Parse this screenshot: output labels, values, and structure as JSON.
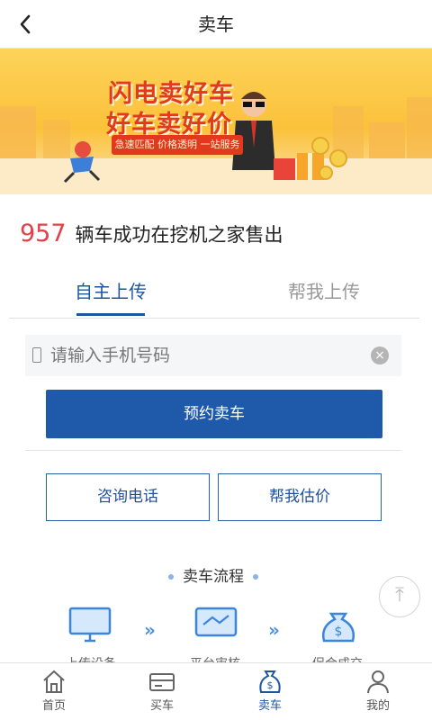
{
  "nav": {
    "back_icon": "chevron-left-icon",
    "back_glyph": "‹",
    "title": "卖车"
  },
  "banner": {
    "slogan_line1": "闪电卖好车",
    "slogan_line2": "好车卖好价",
    "ribbon": "急速匹配 价格透明 一站服务",
    "colors": {
      "background": "#fbc13a",
      "slogan": "#e23a1d"
    }
  },
  "stats": {
    "count": "957",
    "text": "辆车成功在挖机之家售出",
    "count_color": "#e0404a"
  },
  "tabs": [
    {
      "label": "自主上传",
      "active": true
    },
    {
      "label": "帮我上传",
      "active": false
    }
  ],
  "form": {
    "phone_icon": "phone-icon",
    "phone_value": "",
    "phone_placeholder": "请输入手机号码",
    "clear_icon": "clear-icon",
    "clear_glyph": "×",
    "submit_label": "预约卖车"
  },
  "actions": {
    "consult_label": "咨询电话",
    "estimate_label": "帮我估价"
  },
  "process": {
    "title": "卖车流程",
    "steps": [
      {
        "label": "上传设备",
        "icon": "monitor-icon"
      },
      {
        "label": "平台审核",
        "icon": "screen-check-icon"
      },
      {
        "label": "促合成交",
        "icon": "money-bag-icon"
      }
    ],
    "arrow_glyph": "»"
  },
  "back_to_top": {
    "icon": "arrow-up-icon",
    "glyph": "⤒"
  },
  "tabbar": {
    "items": [
      {
        "label": "首页",
        "icon": "home-icon",
        "active": false
      },
      {
        "label": "买车",
        "icon": "truck-card-icon",
        "active": false
      },
      {
        "label": "卖车",
        "icon": "money-bag-icon",
        "active": true
      },
      {
        "label": "我的",
        "icon": "user-icon",
        "active": false
      }
    ]
  },
  "colors": {
    "primary": "#1e5aa9",
    "accent_red": "#e0404a"
  }
}
